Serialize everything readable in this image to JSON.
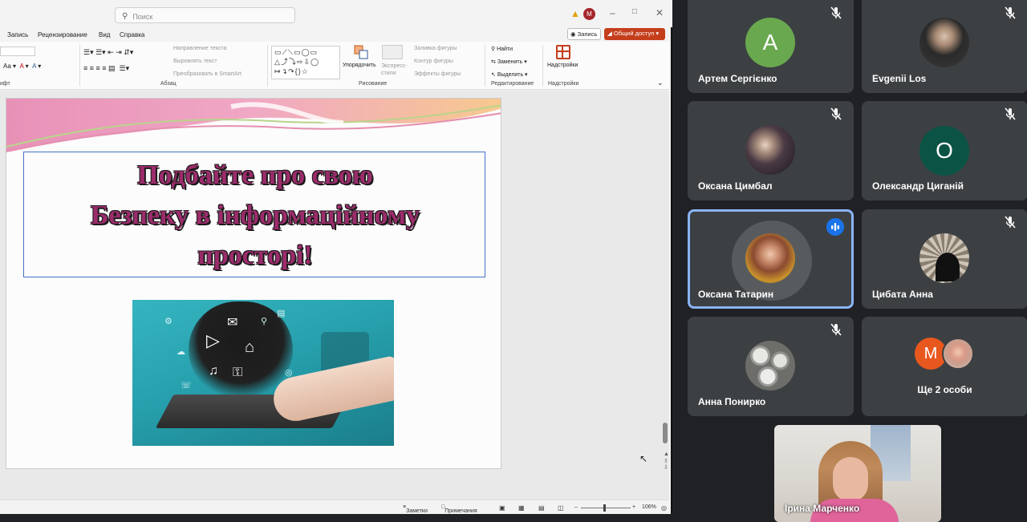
{
  "ppt": {
    "search_placeholder": "Поиск",
    "menu": [
      "Запись",
      "Рецензирование",
      "Вид",
      "Справка"
    ],
    "record_button": "Запись",
    "share_button": "Общий доступ",
    "user_initial": "M",
    "ribbon": {
      "paragraph_items": [
        "Направление текста",
        "Выровнять текст",
        "Преобразовать в SmartArt"
      ],
      "arrange": "Упорядочить",
      "quick_styles": "Экспресс-стили",
      "shape_fill": "Заливка фигуры",
      "shape_outline": "Контур фигуры",
      "shape_effects": "Эффекты фигуры",
      "find": "Найти",
      "replace": "Заменить",
      "select": "Выделить",
      "addins": "Надстройки",
      "group_font_tail": "ифт",
      "group_paragraph": "Абзац",
      "group_drawing": "Рисование",
      "group_editing": "Редактирование",
      "group_addins": "Надстройки"
    },
    "slide": {
      "title_lines": [
        "Подбайте про свою",
        "Безпеку в інформаційному",
        "просторі!"
      ]
    },
    "status": {
      "notes": "Заметки",
      "comments": "Примечания",
      "zoom": "106%"
    }
  },
  "meet": {
    "participants": [
      {
        "name": "Артем Сергієнко",
        "initial": "A",
        "color": "#6aa84f"
      },
      {
        "name": "Evgenii Los"
      },
      {
        "name": "Оксана Цимбал"
      },
      {
        "name": "Олександр Циганій",
        "initial": "О",
        "color": "#0b5345"
      },
      {
        "name": "Оксана Татарин"
      },
      {
        "name": "Цибата Анна"
      },
      {
        "name": "Анна Понирко"
      }
    ],
    "more": {
      "initial": "M",
      "label": "Ще 2 особи"
    },
    "self_view_name": "Ірина Марченко"
  }
}
